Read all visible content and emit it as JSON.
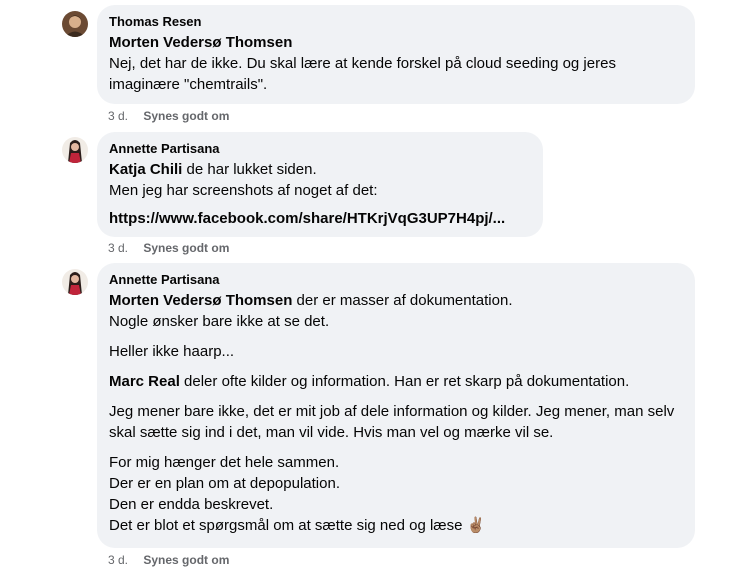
{
  "comments": [
    {
      "author": "Thomas Resen",
      "paragraphs": [
        {
          "mention": "Morten Vedersø Thomsen",
          "text": ""
        },
        {
          "mention": "",
          "text": "Nej, det har de ikke. Du skal lære at kende forskel på cloud seeding og jeres imaginære \"chemtrails\"."
        }
      ],
      "time": "3 d.",
      "like": "Synes godt om"
    },
    {
      "author": "Annette Partisana",
      "paragraphs": [
        {
          "mention": "Katja Chili",
          "text": " de har lukket siden."
        },
        {
          "mention": "",
          "text": "Men jeg har screenshots af noget af det:"
        }
      ],
      "link": "https://www.facebook.com/share/HTKrjVqG3UP7H4pj/...",
      "time": "3 d.",
      "like": "Synes godt om"
    },
    {
      "author": "Annette Partisana",
      "paragraphs": [
        {
          "mention": "Morten Vedersø Thomsen",
          "text": " der er masser af dokumentation."
        },
        {
          "mention": "",
          "text": "Nogle ønsker bare ikke at se det."
        },
        {
          "mention": "",
          "text": "Heller ikke haarp..."
        },
        {
          "mention": "Marc Real",
          "text": " deler ofte kilder og information. Han er ret skarp på dokumentation."
        },
        {
          "mention": "",
          "text": "Jeg mener bare ikke, det er mit job af dele information og kilder. Jeg mener, man selv skal sætte sig ind i det, man vil vide. Hvis man vel og mærke vil se."
        },
        {
          "mention": "",
          "text": "For mig hænger det hele sammen."
        },
        {
          "mention": "",
          "text": "Der er en plan om at depopulation."
        },
        {
          "mention": "",
          "text": "Den er endda beskrevet."
        },
        {
          "mention": "",
          "text": "Det er blot et spørgsmål om at sætte sig ned og læse ✌🏽"
        }
      ],
      "time": "3 d.",
      "like": "Synes godt om"
    }
  ]
}
